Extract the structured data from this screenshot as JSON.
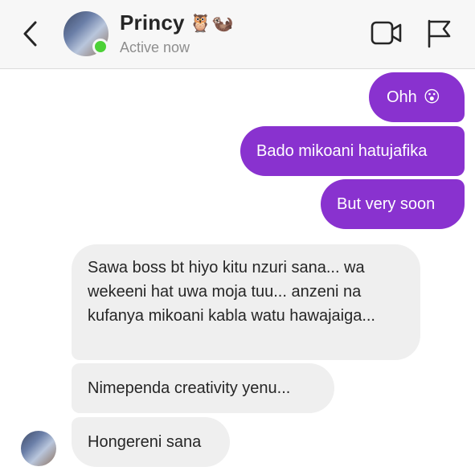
{
  "header": {
    "contact_name": "Princy",
    "name_emojis": "🦉🦦",
    "status": "Active now",
    "back_icon": "chevron-left-icon",
    "video_icon": "video-camera-icon",
    "flag_icon": "flag-icon",
    "online_color": "#4cd137"
  },
  "messages": [
    {
      "side": "sent",
      "text": "Ohh",
      "emoji": "😮"
    },
    {
      "side": "sent",
      "text": "Bado mikoani hatujafika"
    },
    {
      "side": "sent",
      "text": "But very soon"
    },
    {
      "side": "received",
      "text": "Sawa boss bt hiyo kitu nzuri sana... wa wekeeni hat uwa moja tuu... anzeni na kufanya mikoani kabla watu hawajaiga..."
    },
    {
      "side": "received",
      "text": "Nimependa creativity yenu..."
    },
    {
      "side": "received",
      "text": "Hongereni sana"
    }
  ],
  "colors": {
    "sent_bubble": "#8932cf",
    "received_bubble": "#efefef",
    "header_bg": "#f7f7f7"
  }
}
